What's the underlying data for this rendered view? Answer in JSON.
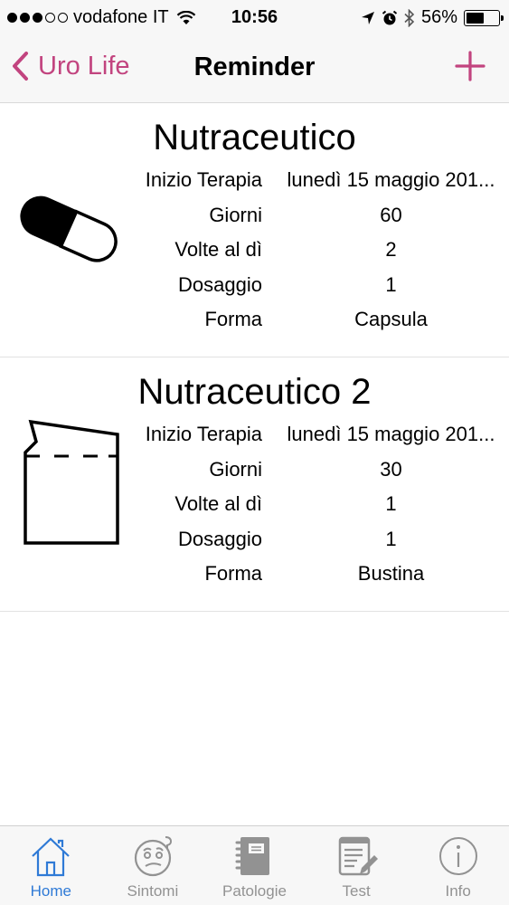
{
  "status_bar": {
    "carrier": "vodafone IT",
    "time": "10:56",
    "battery": "56%",
    "battery_level": 0.56
  },
  "nav": {
    "back_label": "Uro Life",
    "title": "Reminder",
    "accent_color": "#c2447f"
  },
  "reminders": [
    {
      "title": "Nutraceutico",
      "icon": "capsule-icon",
      "rows": [
        {
          "label": "Inizio Terapia",
          "value": "lunedì 15 maggio 201..."
        },
        {
          "label": "Giorni",
          "value": "60"
        },
        {
          "label": "Volte al dì",
          "value": "2"
        },
        {
          "label": "Dosaggio",
          "value": "1"
        },
        {
          "label": "Forma",
          "value": "Capsula"
        }
      ]
    },
    {
      "title": "Nutraceutico 2",
      "icon": "sachet-icon",
      "rows": [
        {
          "label": "Inizio Terapia",
          "value": "lunedì 15 maggio 201..."
        },
        {
          "label": "Giorni",
          "value": "30"
        },
        {
          "label": "Volte al dì",
          "value": "1"
        },
        {
          "label": "Dosaggio",
          "value": "1"
        },
        {
          "label": "Forma",
          "value": "Bustina"
        }
      ]
    }
  ],
  "tabs": [
    {
      "label": "Home",
      "icon": "home-icon",
      "active": true
    },
    {
      "label": "Sintomi",
      "icon": "confused-face-icon",
      "active": false
    },
    {
      "label": "Patologie",
      "icon": "notebook-icon",
      "active": false
    },
    {
      "label": "Test",
      "icon": "checklist-icon",
      "active": false
    },
    {
      "label": "Info",
      "icon": "info-icon",
      "active": false
    }
  ],
  "colors": {
    "tab_active": "#2f7ad6",
    "tab_inactive": "#929292"
  }
}
